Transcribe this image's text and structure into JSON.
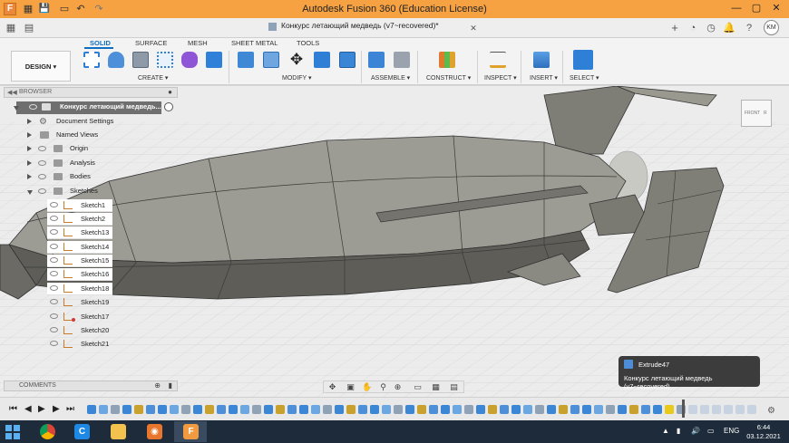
{
  "window": {
    "title": "Autodesk Fusion 360 (Education License)",
    "app_badge": "F",
    "undo_glyph": "↶",
    "redo_glyph": "↷",
    "save_glyph": "💾",
    "grid_glyph": "▦",
    "minimize_glyph": "—",
    "maximize_glyph": "▢",
    "close_glyph": "✕"
  },
  "doc_tab": {
    "name": "Конкурс летающий медведь (v7~recovered)*",
    "close_glyph": "✕",
    "new_tab_glyph": "+",
    "avatar_initials": "KM"
  },
  "ribbon": {
    "workspace": "DESIGN ▾",
    "tabs": [
      "SOLID",
      "SURFACE",
      "MESH",
      "SHEET METAL",
      "TOOLS"
    ],
    "groups": [
      "CREATE ▾",
      "MODIFY ▾",
      "ASSEMBLE ▾",
      "CONSTRUCT ▾",
      "INSPECT ▾",
      "INSERT ▾",
      "SELECT ▾"
    ]
  },
  "browser": {
    "header": "BROWSER",
    "root": "Конкурс летающий медведь...",
    "items": [
      "Document Settings",
      "Named Views",
      "Origin",
      "Analysis",
      "Bodies",
      "Sketches"
    ],
    "sketches": [
      "Sketch1",
      "Sketch2",
      "Sketch13",
      "Sketch14",
      "Sketch15",
      "Sketch16",
      "Sketch18",
      "Sketch19",
      "Sketch17",
      "Sketch20",
      "Sketch21"
    ]
  },
  "comments": {
    "header": "COMMENTS"
  },
  "viewcube": {
    "front": "FRONT",
    "right": "R"
  },
  "tooltip": {
    "feature": "Extrude47",
    "document": "Конкурс летающий медведь (v7~recovered)"
  },
  "navbar": {
    "icons": [
      "✥",
      "▣",
      "✋",
      "⚲",
      "⊕",
      "▭",
      "▦",
      "▤"
    ]
  },
  "timeline": {
    "controls": [
      "⏮",
      "◀",
      "▶",
      "▶",
      "⏭"
    ]
  },
  "taskbar": {
    "language": "ENG",
    "time": "6:44",
    "date": "03.12.2021",
    "apps": [
      "chrome",
      "cortana",
      "files",
      "tasks",
      "fusion"
    ]
  },
  "colors": {
    "titlebar": "#f6a243",
    "accent": "#0e6fc2",
    "hull": "#8d8c86",
    "taskbar": "#1d2b3a"
  }
}
